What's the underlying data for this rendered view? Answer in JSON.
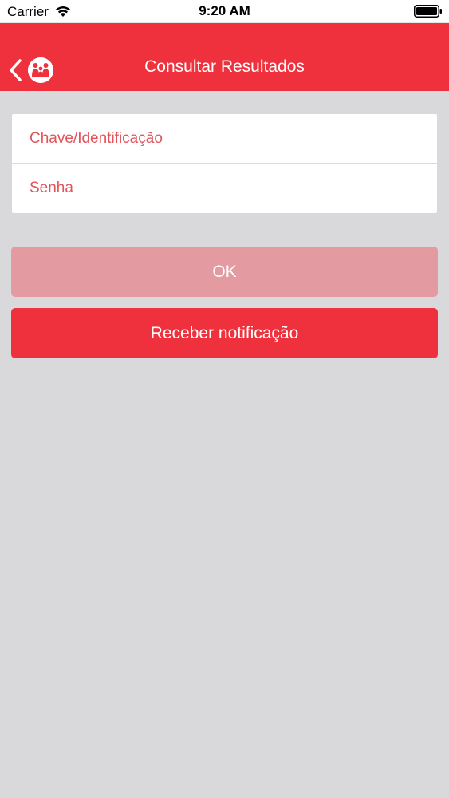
{
  "status_bar": {
    "carrier": "Carrier",
    "time": "9:20 AM"
  },
  "nav_bar": {
    "title": "Consultar Resultados",
    "background_color": "#ee313c"
  },
  "form": {
    "id_field": {
      "placeholder": "Chave/Identificação",
      "value": ""
    },
    "password_field": {
      "placeholder": "Senha",
      "value": ""
    }
  },
  "buttons": {
    "ok_label": "OK",
    "notify_label": "Receber notificação"
  },
  "colors": {
    "accent": "#ee313c",
    "ok_disabled": "#e39aa0",
    "placeholder": "#e0545a",
    "background": "#d9d8da"
  },
  "icons": {
    "back": "chevron-left-icon",
    "logo": "family-logo-icon",
    "wifi": "wifi-icon",
    "battery": "battery-icon"
  }
}
